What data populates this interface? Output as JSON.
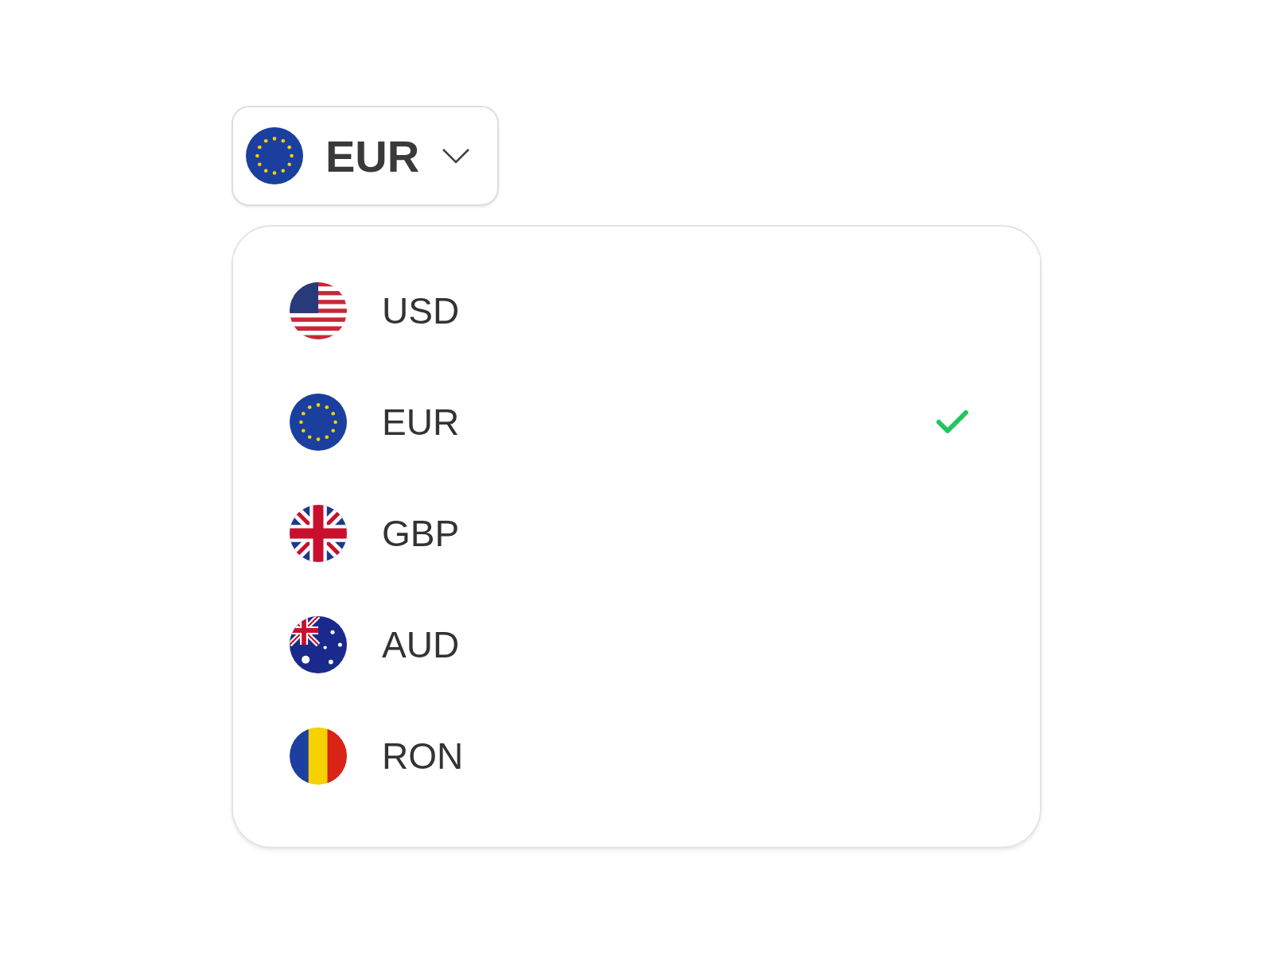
{
  "trigger": {
    "kind": "eu",
    "label": "EUR"
  },
  "options": [
    {
      "kind": "us",
      "label": "USD",
      "selected": false
    },
    {
      "kind": "eu",
      "label": "EUR",
      "selected": true
    },
    {
      "kind": "gb",
      "label": "GBP",
      "selected": false
    },
    {
      "kind": "au",
      "label": "AUD",
      "selected": false
    },
    {
      "kind": "ro",
      "label": "RON",
      "selected": false
    }
  ]
}
